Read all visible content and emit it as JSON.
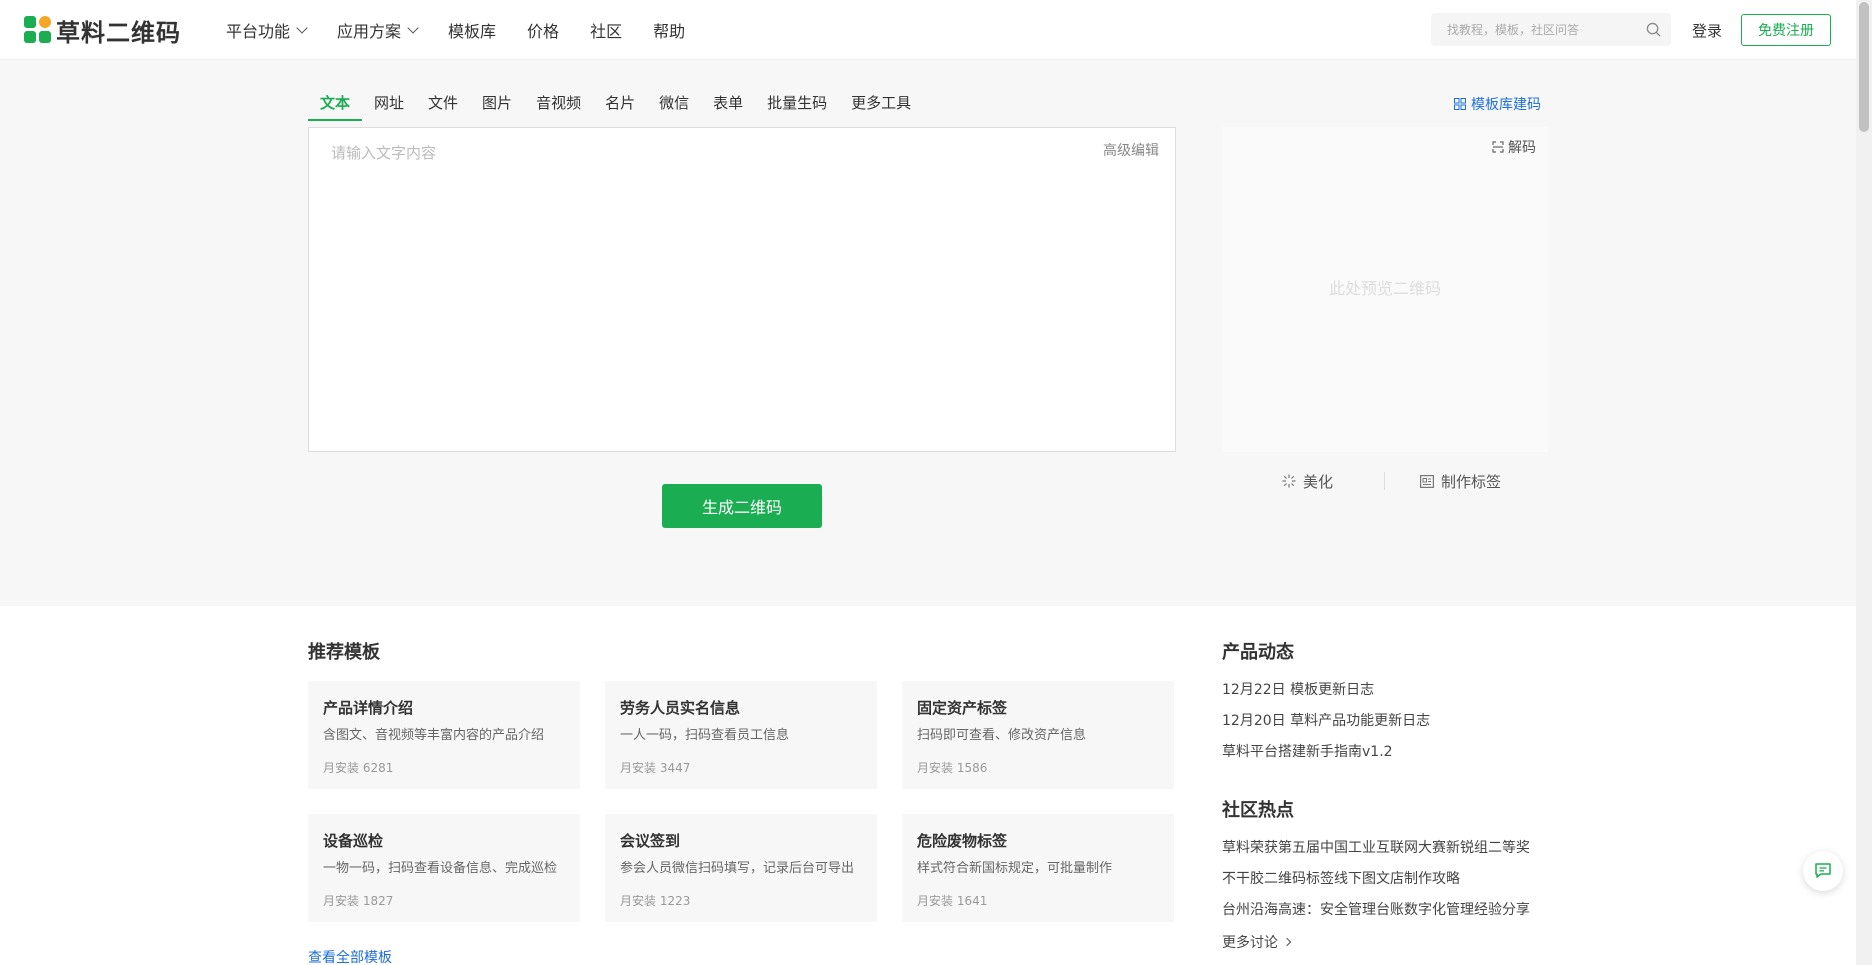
{
  "header": {
    "logo_text": "草料二维码",
    "nav": [
      {
        "label": "平台功能",
        "dropdown": true
      },
      {
        "label": "应用方案",
        "dropdown": true
      },
      {
        "label": "模板库",
        "dropdown": false
      },
      {
        "label": "价格",
        "dropdown": false
      },
      {
        "label": "社区",
        "dropdown": false
      },
      {
        "label": "帮助",
        "dropdown": false
      }
    ],
    "search_placeholder": "找教程，模板，社区问答",
    "login_label": "登录",
    "register_label": "免费注册"
  },
  "tool": {
    "tabs": [
      "文本",
      "网址",
      "文件",
      "图片",
      "音视频",
      "名片",
      "微信",
      "表单",
      "批量生码",
      "更多工具"
    ],
    "active_tab": "文本",
    "template_link": "模板库建码",
    "editor_placeholder": "请输入文字内容",
    "advanced_edit": "高级编辑",
    "generate_label": "生成二维码",
    "decode_label": "解码",
    "preview_placeholder": "此处预览二维码",
    "beautify_label": "美化",
    "make_label_label": "制作标签"
  },
  "recommended": {
    "title": "推荐模板",
    "cards": [
      {
        "title": "产品详情介绍",
        "desc": "含图文、音视频等丰富内容的产品介绍",
        "meta": "月安装 6281"
      },
      {
        "title": "劳务人员实名信息",
        "desc": "一人一码，扫码查看员工信息",
        "meta": "月安装 3447"
      },
      {
        "title": "固定资产标签",
        "desc": "扫码即可查看、修改资产信息",
        "meta": "月安装 1586"
      },
      {
        "title": "设备巡检",
        "desc": "一物一码，扫码查看设备信息、完成巡检",
        "meta": "月安装 1827"
      },
      {
        "title": "会议签到",
        "desc": "参会人员微信扫码填写，记录后台可导出",
        "meta": "月安装 1223"
      },
      {
        "title": "危险废物标签",
        "desc": "样式符合新国标规定，可批量制作",
        "meta": "月安装 1641"
      }
    ],
    "view_all": "查看全部模板"
  },
  "product_news": {
    "title": "产品动态",
    "items": [
      "12月22日 模板更新日志",
      "12月20日 草料产品功能更新日志",
      "草料平台搭建新手指南v1.2"
    ]
  },
  "community": {
    "title": "社区热点",
    "items": [
      "草料荣获第五届中国工业互联网大赛新锐组二等奖",
      "不干胶二维码标签线下图文店制作攻略",
      "台州沿海高速：安全管理台账数字化管理经验分享"
    ],
    "more": "更多讨论"
  },
  "colors": {
    "brand_green": "#1aad52",
    "link_blue": "#1e6fd9"
  }
}
